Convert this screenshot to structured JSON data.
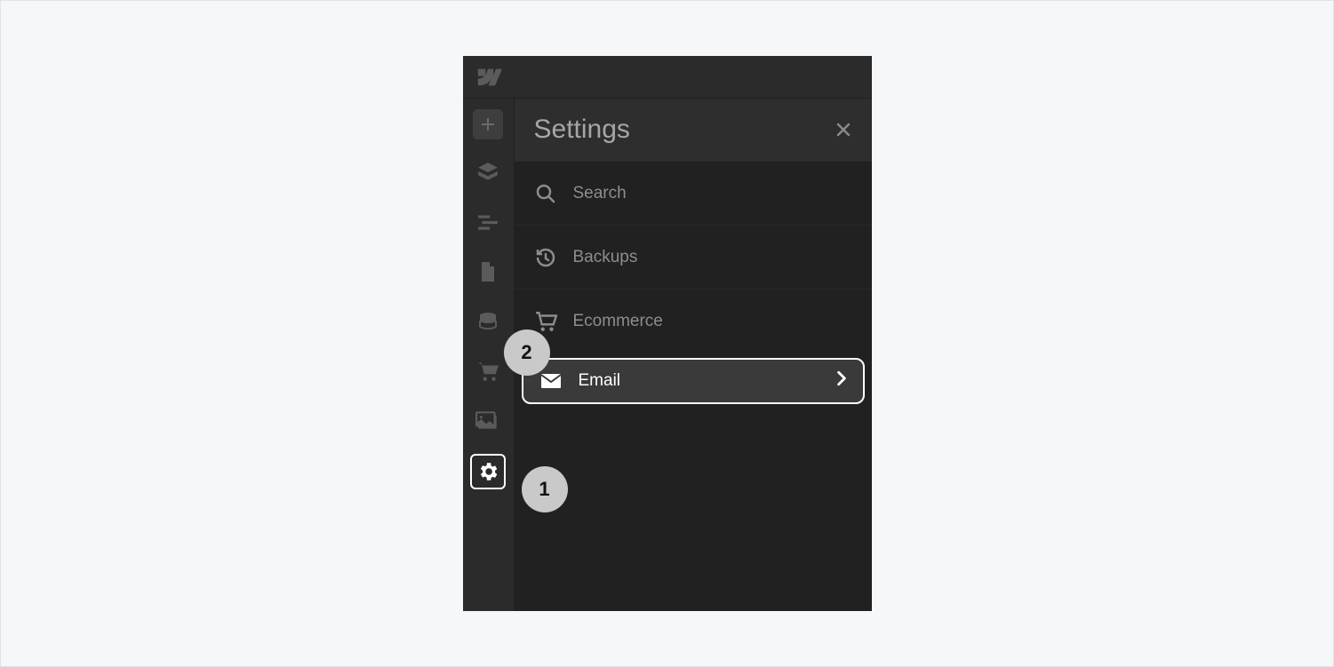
{
  "panel": {
    "title": "Settings",
    "items": [
      {
        "label": "Search"
      },
      {
        "label": "Backups"
      },
      {
        "label": "Ecommerce"
      },
      {
        "label": "Email"
      }
    ]
  },
  "steps": {
    "one": "1",
    "two": "2"
  }
}
